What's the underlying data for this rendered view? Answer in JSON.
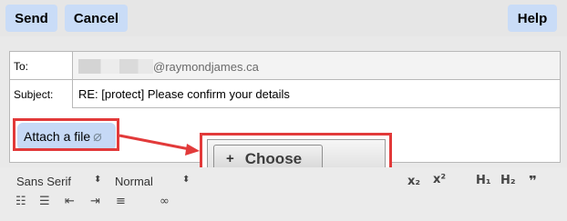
{
  "header": {
    "send_label": "Send",
    "cancel_label": "Cancel",
    "help_label": "Help"
  },
  "form": {
    "to_label": "To:",
    "to_value": "@raymondjames.ca",
    "subject_label": "Subject:",
    "subject_value": "RE: [protect] Please confirm your details"
  },
  "attach": {
    "label": "Attach a file",
    "clip_icon": "paperclip-icon"
  },
  "file_picker": {
    "choose_label": "Choose",
    "plus_icon": "plus-icon"
  },
  "toolbar": {
    "font_select": "Sans Serif",
    "size_select": "Normal",
    "subscript": "x₂",
    "superscript": "x²",
    "h1": "H₁",
    "h2": "H₂",
    "quote": "❞"
  },
  "colors": {
    "button_bg": "#c9dcf7",
    "highlight": "#e23a3a"
  }
}
